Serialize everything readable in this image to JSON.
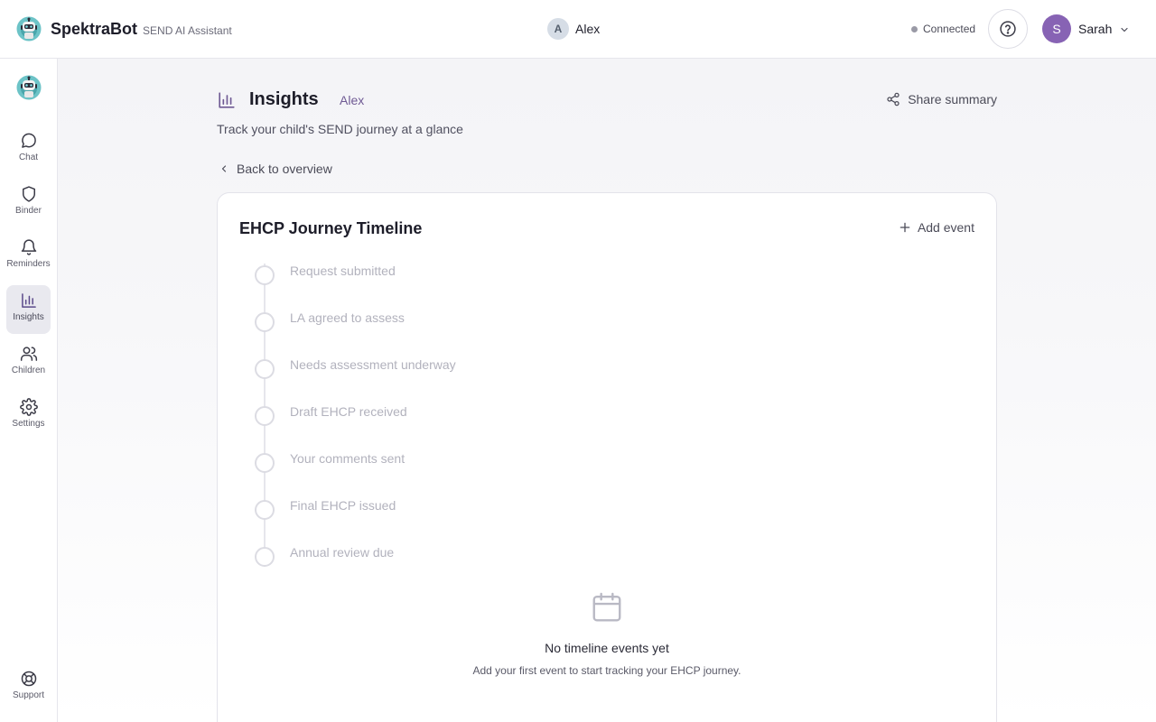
{
  "header": {
    "brand_name": "SpektraBot",
    "brand_sub": "SEND AI Assistant",
    "child_initial": "A",
    "child_name": "Alex",
    "status": "Connected",
    "user_initial": "S",
    "user_name": "Sarah"
  },
  "sidebar": {
    "items": [
      {
        "label": "Chat",
        "icon": "chat-bubble-icon"
      },
      {
        "label": "Binder",
        "icon": "shield-icon"
      },
      {
        "label": "Reminders",
        "icon": "bell-icon"
      },
      {
        "label": "Insights",
        "icon": "bar-chart-icon",
        "active": true
      },
      {
        "label": "Children",
        "icon": "users-icon"
      },
      {
        "label": "Settings",
        "icon": "gear-icon"
      }
    ],
    "support_label": "Support"
  },
  "page": {
    "title": "Insights",
    "child_name": "Alex",
    "share_label": "Share summary",
    "subtitle": "Track your child's SEND journey at a glance",
    "back_label": "Back to overview"
  },
  "card": {
    "title": "EHCP Journey Timeline",
    "add_label": "Add event",
    "timeline": [
      "Request submitted",
      "LA agreed to assess",
      "Needs assessment underway",
      "Draft EHCP received",
      "Your comments sent",
      "Final EHCP issued",
      "Annual review due"
    ],
    "empty_title": "No timeline events yet",
    "empty_text": "Add your first event to start tracking your EHCP journey."
  },
  "colors": {
    "accent": "#8763b4",
    "child_tag": "#6f5a94",
    "status_dot": "#9a9aa6"
  }
}
